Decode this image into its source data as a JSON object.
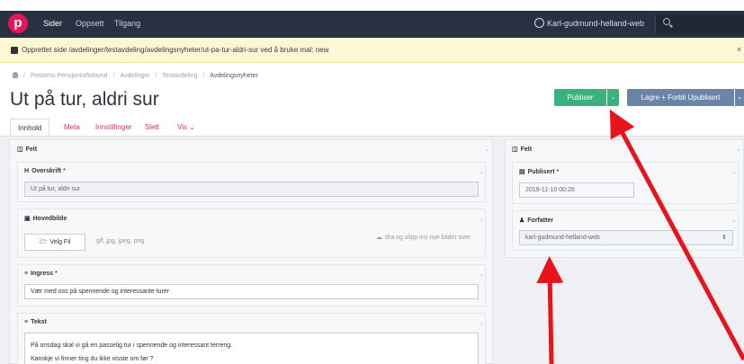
{
  "nav": {
    "logo": "p",
    "items": [
      "Sider",
      "Oppsett",
      "Tilgang"
    ],
    "user": "Karl-gudmund-helland-web"
  },
  "alert": {
    "message": "Opprettet side /avdelinger/testavdeling/avdelingsnyheter/ut-pa-tur-aldri-sur ved å bruke mal: new",
    "close": "×"
  },
  "breadcrumb": [
    "Posterns Pensjonistforbund",
    "Avdelinger",
    "Testavdeling",
    "Avdelingsnyheter"
  ],
  "page": {
    "title": "Ut på tur, aldri sur"
  },
  "actions": {
    "publish": "Publiser",
    "save": "Lagre + Forbli Upublisert"
  },
  "tabs": [
    "Innhold",
    "Meta",
    "Innstillinger",
    "Slett",
    "Vis"
  ],
  "left": {
    "panel_title": "Felt",
    "headline_label": "Overskrift",
    "headline_value": "Ut på tur, aldri sur",
    "image_label": "Hovedbilde",
    "file_button": "Velg Fil",
    "file_types": "gif, jpg, jpeg, png",
    "drop_hint": "dra og slipp inn nye bilder over",
    "ingress_label": "Ingress",
    "ingress_value": "Vær med oss på spennende og interessante turer",
    "text_label": "Tekst",
    "text_line1": "På onsdag skal vi gå en passelig tur i spennende og interessant terreng.",
    "text_line2": "Kanskje vi finner ting du ikke visste om før ?"
  },
  "right": {
    "panel_title": "Felt",
    "published_label": "Publisert",
    "published_value": "2019-11-10 00:26",
    "author_label": "Forfatter",
    "author_value": "karl-gudmund-helland-web"
  },
  "colors": {
    "navbar": "#283142",
    "brand": "#e4165a",
    "publish": "#3bb27e",
    "save": "#6b85a8",
    "alert_bg": "#fcf8d6",
    "annotation_arrow": "#e8141b"
  }
}
